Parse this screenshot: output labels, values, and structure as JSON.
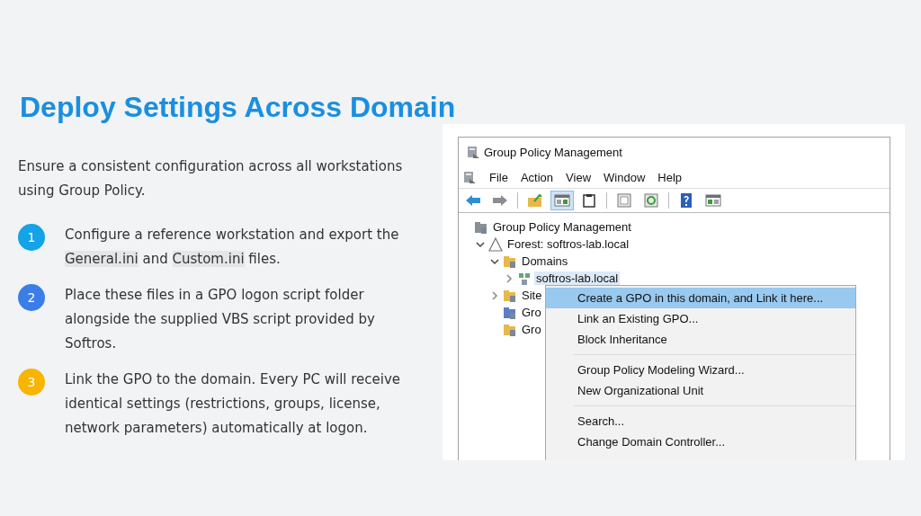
{
  "title": "Deploy Settings Across Domain",
  "intro": "Ensure a consistent configuration across all workstations using Group Policy.",
  "steps": [
    {
      "number": "1",
      "color": "#13a3e6",
      "parts": [
        {
          "kind": "text",
          "text": "Configure a reference workstation and export the "
        },
        {
          "kind": "code",
          "text": "General.ini"
        },
        {
          "kind": "text",
          "text": " and "
        },
        {
          "kind": "code",
          "text": "Custom.ini"
        },
        {
          "kind": "text",
          "text": " files."
        }
      ]
    },
    {
      "number": "2",
      "color": "#3b7ee8",
      "parts": [
        {
          "kind": "text",
          "text": "Place these files in a GPO logon script folder alongside the supplied VBS script provided by Softros."
        }
      ]
    },
    {
      "number": "3",
      "color": "#f7b500",
      "parts": [
        {
          "kind": "text",
          "text": "Link the GPO to the domain. Every PC will receive identical settings (restrictions, groups, license, network parameters) automatically at logon."
        }
      ]
    }
  ],
  "window": {
    "title": "Group Policy Management",
    "menu": [
      "File",
      "Action",
      "View",
      "Window",
      "Help"
    ],
    "toolbar": [
      {
        "kind": "back",
        "selected": false
      },
      {
        "kind": "forward",
        "selected": false
      },
      {
        "kind": "sep"
      },
      {
        "kind": "up",
        "selected": false
      },
      {
        "kind": "tree",
        "selected": true
      },
      {
        "kind": "clipboard",
        "selected": false
      },
      {
        "kind": "sep"
      },
      {
        "kind": "properties",
        "selected": false
      },
      {
        "kind": "refresh",
        "selected": false
      },
      {
        "kind": "sep"
      },
      {
        "kind": "help",
        "selected": false
      },
      {
        "kind": "pane",
        "selected": false
      }
    ],
    "tree": [
      {
        "label": "Group Policy Management",
        "kind": "console",
        "selected": false,
        "children": [
          {
            "label": "Forest: softros-lab.local",
            "kind": "forest",
            "expanded": true,
            "selected": false,
            "children": [
              {
                "label": "Domains",
                "kind": "domains",
                "expanded": true,
                "selected": false,
                "children": [
                  {
                    "label": "softros-lab.local",
                    "kind": "domain",
                    "expanded": false,
                    "selected": true
                  }
                ]
              },
              {
                "label": "Site",
                "kind": "sites",
                "expanded": false,
                "selected": false
              },
              {
                "label": "Gro",
                "kind": "modeling",
                "selected": false
              },
              {
                "label": "Gro",
                "kind": "results",
                "selected": false
              }
            ]
          }
        ]
      }
    ],
    "context_menu": [
      [
        {
          "label": "Create a GPO in this domain, and Link it here...",
          "selected": true
        },
        {
          "label": "Link an Existing GPO...",
          "selected": false
        },
        {
          "label": "Block Inheritance",
          "selected": false
        }
      ],
      [
        {
          "label": "Group Policy Modeling Wizard...",
          "selected": false
        },
        {
          "label": "New Organizational Unit",
          "selected": false
        }
      ],
      [
        {
          "label": "Search...",
          "selected": false
        },
        {
          "label": "Change Domain Controller...",
          "selected": false
        }
      ]
    ]
  }
}
